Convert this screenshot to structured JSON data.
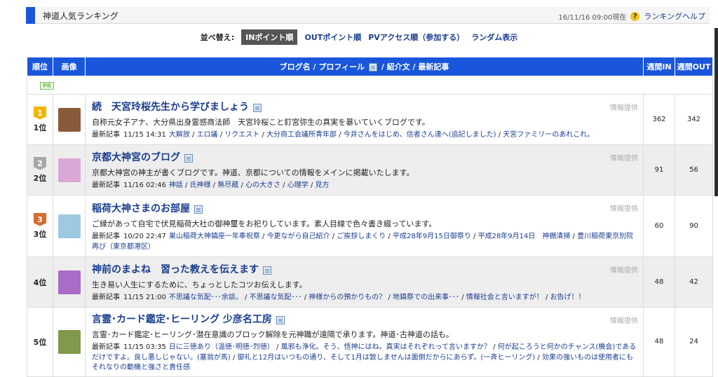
{
  "header": {
    "title": "神道人気ランキング",
    "timestamp": "16/11/16 09:00現在",
    "help_icon": "?",
    "help_label": "ランキングヘルプ"
  },
  "sort": {
    "label": "並べ替え:",
    "options": [
      "INポイント順",
      "OUTポイント順",
      "PVアクセス順（参加する）",
      "ランダム表示"
    ],
    "active": "INポイント順"
  },
  "table": {
    "headers": {
      "rank": "順位",
      "image": "画像",
      "main_left": "ブログ名 / プロフィール",
      "main_right": "/ 紹介文 / 最新記事",
      "weekly_in": "週間IN",
      "weekly_out": "週間OUT"
    },
    "pr_label": "PR",
    "report_label": "情報提供",
    "recent_label": "最新記事",
    "rows": [
      {
        "medal": "1",
        "rank": "1位",
        "title": "続　天宮玲桜先生から学びましょう",
        "intro": "自称元女子アナ、大分県出身霊感商法師　天宮玲桜こと釘宮弥生の真実を暴いていくブログです。",
        "time": "11/15 14:31",
        "articles": [
          "大解放",
          "エロ議",
          "リクエスト",
          "大分商工会議所青年部",
          "今井さんをはじめ、信者さん達へ(追記しました)",
          "天宮ファミリーのあれこれ。"
        ],
        "in": "362",
        "out": "342",
        "thumb_color": "#8a5a3c"
      },
      {
        "medal": "2",
        "rank": "2位",
        "title": "京都大神宮のブログ",
        "intro": "京都大神宮の神主が書くブログです。神道、京都についての情報をメインに掲載いたします。",
        "time": "11/16 02:46",
        "articles": [
          "神話",
          "氏神様",
          "無尽蔵",
          "心の大きさ",
          "心理学",
          "見方"
        ],
        "in": "91",
        "out": "56",
        "thumb_color": "#d9a8d6"
      },
      {
        "medal": "3",
        "rank": "3位",
        "title": "稲荷大神さまのお部屋",
        "intro": "ご縁があって自宅で伏見稲荷大社の御神璽をお祀りしています。素人目線で色々書き綴っています。",
        "time": "10/20 22:47",
        "articles": [
          "巣山稲荷大神鎮座一年奉祝祭",
          "今更ながら自己紹介",
          "ご挨拶しまくり",
          "平成28年9月15日御祭り",
          "平成28年9月14日　神棚清掃",
          "豊川稲荷東京別院再び（東京都港区）"
        ],
        "in": "60",
        "out": "90",
        "thumb_color": "#9fc9e3"
      },
      {
        "medal": "",
        "rank": "4位",
        "title": "神前のまよね　習った教えを伝えます",
        "intro": "生き易い人生にするために、ちょっとしたコツお伝えします。",
        "time": "11/15 21:00",
        "articles": [
          "不思議な気配･･･余談。",
          "不思議な気配･･･",
          "神様からの預かりもの？",
          "地鎮祭での出来事･･･",
          "情報社会と言いますが！",
          "お告げ！！"
        ],
        "in": "48",
        "out": "42",
        "thumb_color": "#a96cc8"
      },
      {
        "medal": "",
        "rank": "5位",
        "title": "言霊･カード鑑定･ヒーリング 少彦名工房",
        "intro": "言霊･カード鑑定･ヒーリング･潜在意識のブロック解除を元神職が遠隔で承ります。神道･古神道の話も。",
        "time": "11/15 03:35",
        "articles": [
          "日に三徳あり（温徳･明徳･烈徳）",
          "風邪も浄化。そう、悟神にはね。真実はそれぞれって言いますか？",
          "何が起ころうと何かのチャンス(機会)であるだけですよ。良し悪しじゃない。(塞翁が馬)",
          "御礼と12月はいつもの通り、そして1月は致しませんは面倒だからにあらず。(一斉ヒーリング)",
          "効果の強いものは使用者にもそれなりの動機と強さと責任感"
        ],
        "in": "48",
        "out": "24",
        "thumb_color": "#7e9a4a"
      }
    ]
  }
}
